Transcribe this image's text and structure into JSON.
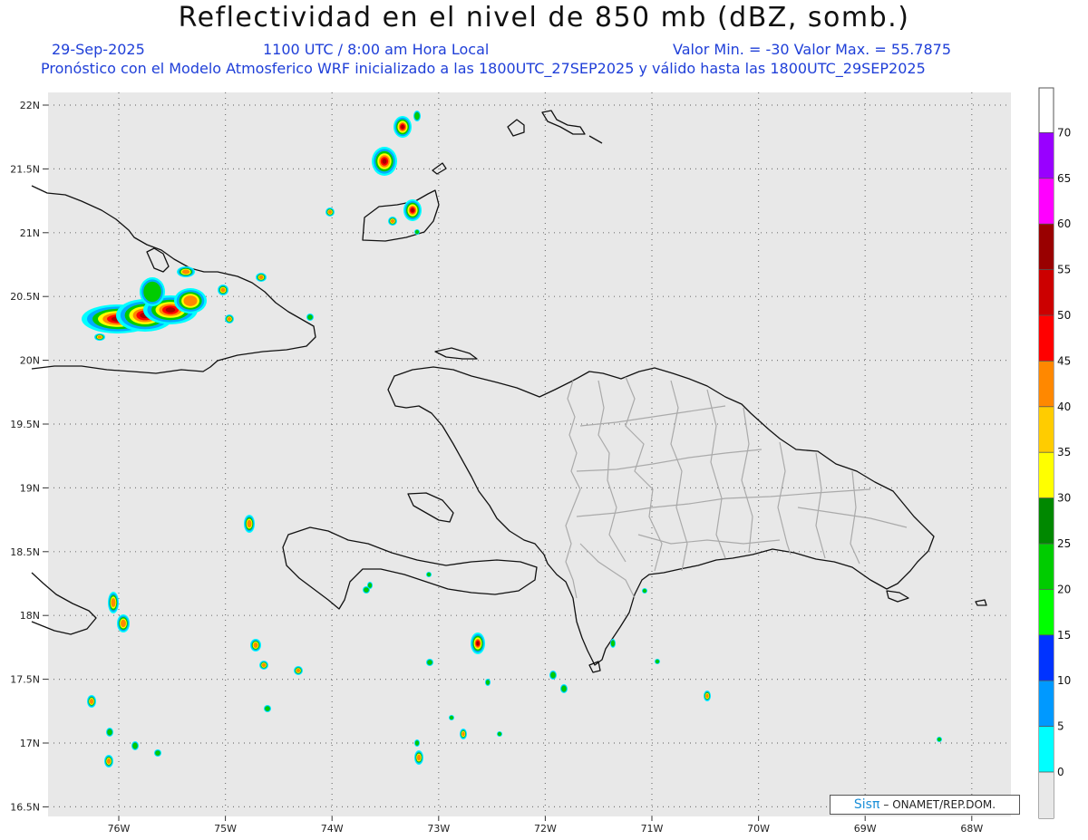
{
  "header": {
    "title": "Reflectividad en el nivel de 850 mb (dBZ, somb.)",
    "date": "29-Sep-2025",
    "time": "1100 UTC / 8:00 am Hora Local",
    "value_range": "Valor Min. = -30  Valor Max. = 55.7875",
    "forecast_info": "Pronóstico con el Modelo Atmosferico WRF inicializado a las 1800UTC_27SEP2025 y válido hasta las  1800UTC_29SEP2025"
  },
  "map": {
    "lat_labels": [
      "22N",
      "21.5N",
      "21N",
      "20.5N",
      "20N",
      "19.5N",
      "19N",
      "18.5N",
      "18N",
      "17.5N",
      "17N",
      "16.5N"
    ],
    "lon_labels": [
      "76W",
      "75W",
      "74W",
      "73W",
      "72W",
      "71W",
      "70W",
      "69W",
      "68W"
    ],
    "background_color": "#e8e8e8"
  },
  "colorbar": {
    "labels": [
      "0",
      "5",
      "10",
      "15",
      "20",
      "25",
      "30",
      "35",
      "40",
      "45",
      "50",
      "55",
      "60",
      "65",
      "70"
    ],
    "colors": [
      "#00ffff",
      "#0099ff",
      "#0033ff",
      "#00ff00",
      "#00cc00",
      "#008800",
      "#ffff00",
      "#ffcc00",
      "#ff8800",
      "#ff0000",
      "#cc0000",
      "#990000",
      "#ff00ff",
      "#9900ff"
    ]
  },
  "credit": {
    "logo": "Sisπ",
    "org": "– ONAMET/REP.DOM."
  }
}
